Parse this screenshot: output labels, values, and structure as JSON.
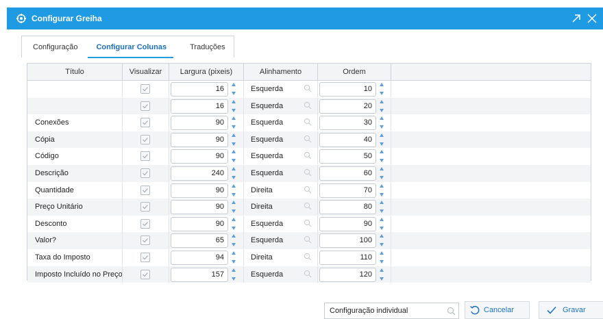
{
  "window": {
    "title": "Configurar Greiha"
  },
  "tabs": [
    {
      "label": "Configuração"
    },
    {
      "label": "Configurar Colunas"
    },
    {
      "label": "Traduções"
    }
  ],
  "grid": {
    "headers": {
      "title": "Título",
      "visualizar": "Visualizar",
      "largura": "Largura (pixeis)",
      "alinhamento": "Alinhamento",
      "ordem": "Ordem"
    },
    "rows": [
      {
        "title": "",
        "visible": true,
        "width": "16",
        "align": "Esquerda",
        "order": "10"
      },
      {
        "title": "",
        "visible": true,
        "width": "16",
        "align": "Esquerda",
        "order": "20"
      },
      {
        "title": "Conexões",
        "visible": true,
        "width": "90",
        "align": "Esquerda",
        "order": "30"
      },
      {
        "title": "Cópia",
        "visible": true,
        "width": "90",
        "align": "Esquerda",
        "order": "40"
      },
      {
        "title": "Código",
        "visible": true,
        "width": "90",
        "align": "Esquerda",
        "order": "50"
      },
      {
        "title": "Descrição",
        "visible": true,
        "width": "240",
        "align": "Esquerda",
        "order": "60"
      },
      {
        "title": "Quantidade",
        "visible": true,
        "width": "90",
        "align": "Direita",
        "order": "70"
      },
      {
        "title": "Preço Unitário",
        "visible": true,
        "width": "90",
        "align": "Direita",
        "order": "80"
      },
      {
        "title": "Desconto",
        "visible": true,
        "width": "90",
        "align": "Esquerda",
        "order": "90"
      },
      {
        "title": "Valor?",
        "visible": true,
        "width": "65",
        "align": "Esquerda",
        "order": "100"
      },
      {
        "title": "Taxa do Imposto",
        "visible": true,
        "width": "94",
        "align": "Direita",
        "order": "110"
      },
      {
        "title": "Imposto Incluído no Preço",
        "visible": true,
        "width": "157",
        "align": "Esquerda",
        "order": "120"
      }
    ]
  },
  "footer": {
    "config_value": "Configuração individual",
    "cancel_label": "Cancelar",
    "save_label": "Gravar"
  },
  "colors": {
    "accent": "#1e9be3",
    "link": "#1a73c7"
  }
}
